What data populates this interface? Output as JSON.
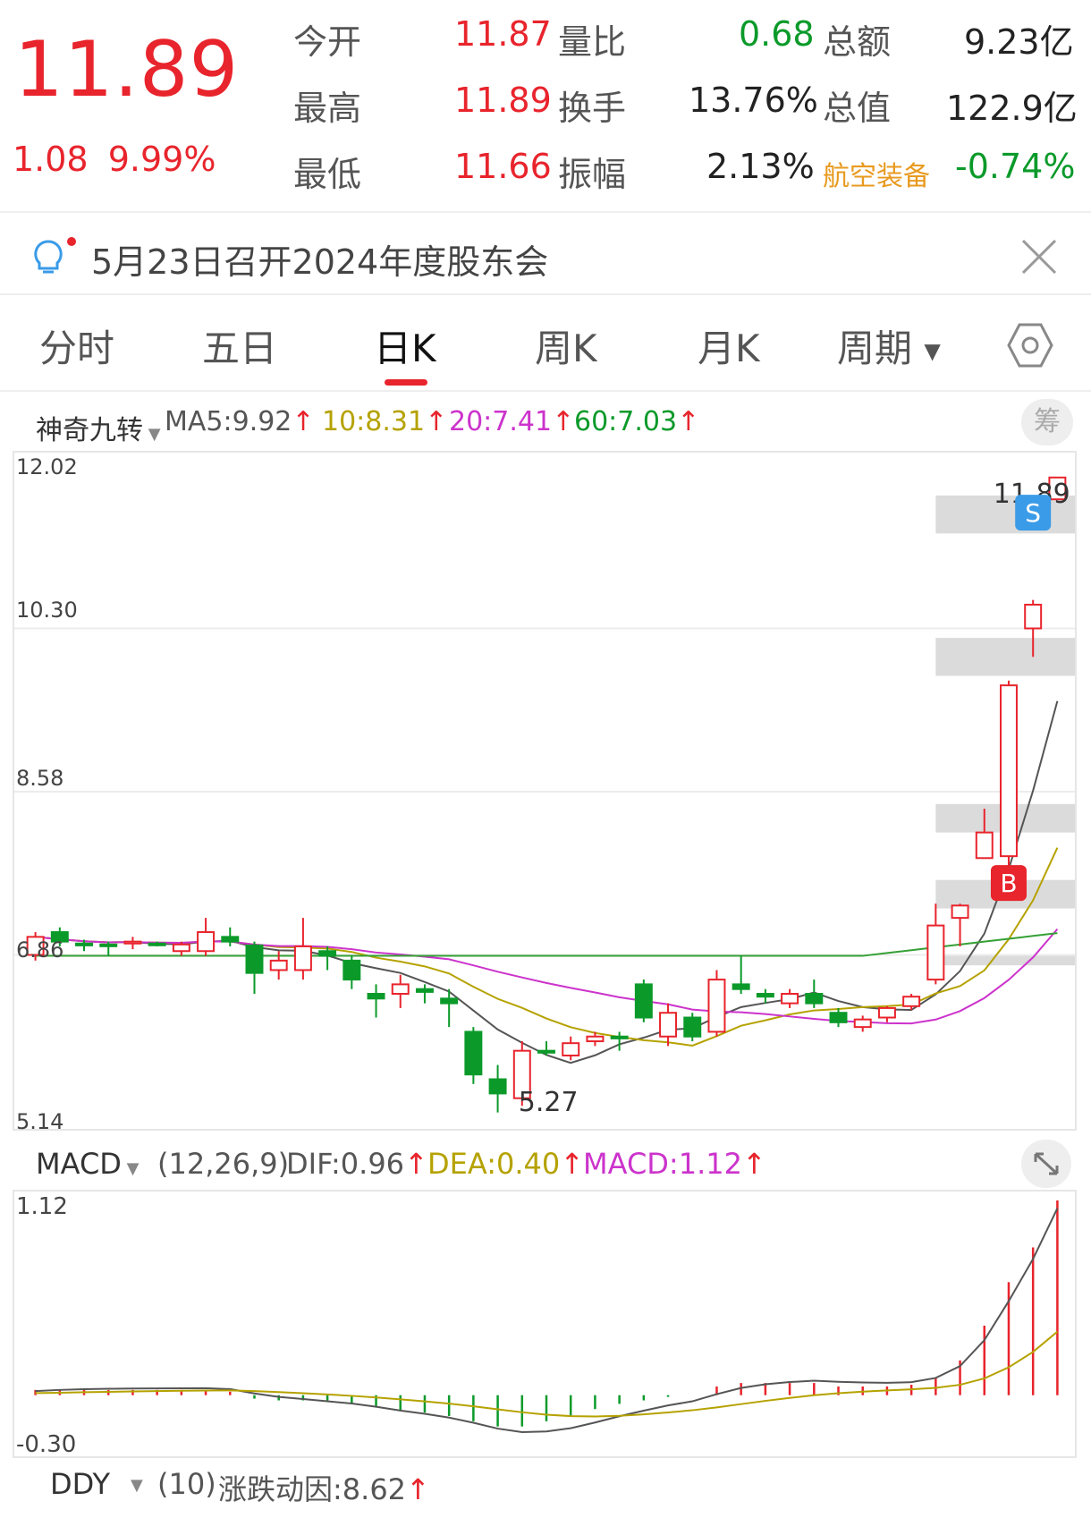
{
  "quote": {
    "price": "11.89",
    "change": "1.08",
    "change_pct": "9.99%",
    "fields": [
      {
        "label": "今开",
        "value": "11.87",
        "color": "#e8242c"
      },
      {
        "label": "量比",
        "value": "0.68",
        "color": "#0b9a2a"
      },
      {
        "label": "总额",
        "value": "9.23亿",
        "color": "#222222"
      },
      {
        "label": "最高",
        "value": "11.89",
        "color": "#e8242c"
      },
      {
        "label": "换手",
        "value": "13.76%",
        "color": "#222222"
      },
      {
        "label": "总值",
        "value": "122.9亿",
        "color": "#222222"
      },
      {
        "label": "最低",
        "value": "11.66",
        "color": "#e8242c"
      },
      {
        "label": "振幅",
        "value": "2.13%",
        "color": "#222222"
      }
    ],
    "sector": {
      "name": "航空装备",
      "change": "-0.74%",
      "name_color": "#e89a1f",
      "change_color": "#0b9a2a"
    }
  },
  "notice": {
    "text": "5月23日召开2024年度股东会",
    "icon": "lightbulb-icon",
    "close_icon": "close-icon"
  },
  "tabs": [
    {
      "label": "分时",
      "active": false
    },
    {
      "label": "五日",
      "active": false
    },
    {
      "label": "日K",
      "active": true
    },
    {
      "label": "周K",
      "active": false
    },
    {
      "label": "月K",
      "active": false
    },
    {
      "label": "周期",
      "active": false,
      "dropdown": true
    }
  ],
  "settings_icon": "hexagon-settings-icon",
  "indicator": {
    "name": "神奇九转",
    "ma5": "MA5:9.92",
    "ma10": "10:8.31",
    "ma20": "20:7.41",
    "ma60": "60:7.03",
    "chip_label": "筹"
  },
  "kline_axis": {
    "top": "12.02",
    "mid1": "10.30",
    "mid2": "8.58",
    "low_label": "6.86",
    "bottom": "5.14"
  },
  "kline_annotations": {
    "high": "11.89",
    "low": "5.27",
    "buy": "B",
    "sell": "S"
  },
  "macd": {
    "name": "MACD",
    "params": "(12,26,9)",
    "dif": "DIF:0.96",
    "dea": "DEA:0.40",
    "macd": "MACD:1.12",
    "axis_top": "1.12",
    "axis_bottom": "-0.30"
  },
  "ddy": {
    "name": "DDY",
    "params": "(10)",
    "value": "涨跌动因:8.62"
  },
  "chart_data": {
    "type": "candlestick",
    "ylim": [
      5.14,
      12.02
    ],
    "candles": [
      {
        "o": 6.86,
        "c": 7.05,
        "h": 7.1,
        "l": 6.8
      },
      {
        "o": 7.1,
        "c": 7.0,
        "h": 7.15,
        "l": 6.95
      },
      {
        "o": 6.98,
        "c": 6.96,
        "h": 7.02,
        "l": 6.9
      },
      {
        "o": 6.97,
        "c": 6.96,
        "h": 7.0,
        "l": 6.85
      },
      {
        "o": 6.98,
        "c": 7.0,
        "h": 7.05,
        "l": 6.92
      },
      {
        "o": 6.98,
        "c": 6.97,
        "h": 7.0,
        "l": 6.95
      },
      {
        "o": 6.9,
        "c": 6.97,
        "h": 7.0,
        "l": 6.85
      },
      {
        "o": 6.9,
        "c": 7.1,
        "h": 7.25,
        "l": 6.85
      },
      {
        "o": 7.05,
        "c": 7.0,
        "h": 7.15,
        "l": 6.95
      },
      {
        "o": 6.96,
        "c": 6.67,
        "h": 7.0,
        "l": 6.45
      },
      {
        "o": 6.7,
        "c": 6.8,
        "h": 6.9,
        "l": 6.6
      },
      {
        "o": 6.7,
        "c": 6.95,
        "h": 7.25,
        "l": 6.6
      },
      {
        "o": 6.9,
        "c": 6.85,
        "h": 6.95,
        "l": 6.7
      },
      {
        "o": 6.8,
        "c": 6.6,
        "h": 6.85,
        "l": 6.5
      },
      {
        "o": 6.45,
        "c": 6.4,
        "h": 6.55,
        "l": 6.2
      },
      {
        "o": 6.45,
        "c": 6.55,
        "h": 6.65,
        "l": 6.3
      },
      {
        "o": 6.5,
        "c": 6.47,
        "h": 6.55,
        "l": 6.35
      },
      {
        "o": 6.4,
        "c": 6.35,
        "h": 6.5,
        "l": 6.1
      },
      {
        "o": 6.05,
        "c": 5.6,
        "h": 6.1,
        "l": 5.5
      },
      {
        "o": 5.55,
        "c": 5.4,
        "h": 5.7,
        "l": 5.2
      },
      {
        "o": 5.35,
        "c": 5.85,
        "h": 5.95,
        "l": 5.27
      },
      {
        "o": 5.85,
        "c": 5.83,
        "h": 5.95,
        "l": 5.8
      },
      {
        "o": 5.8,
        "c": 5.93,
        "h": 6.0,
        "l": 5.75
      },
      {
        "o": 5.95,
        "c": 6.0,
        "h": 6.05,
        "l": 5.9
      },
      {
        "o": 6.0,
        "c": 5.98,
        "h": 6.05,
        "l": 5.85
      },
      {
        "o": 6.55,
        "c": 6.2,
        "h": 6.6,
        "l": 6.15
      },
      {
        "o": 6.0,
        "c": 6.25,
        "h": 6.35,
        "l": 5.9
      },
      {
        "o": 6.2,
        "c": 6.0,
        "h": 6.25,
        "l": 5.95
      },
      {
        "o": 6.05,
        "c": 6.6,
        "h": 6.7,
        "l": 6.0
      },
      {
        "o": 6.55,
        "c": 6.5,
        "h": 6.85,
        "l": 6.45
      },
      {
        "o": 6.45,
        "c": 6.42,
        "h": 6.5,
        "l": 6.35
      },
      {
        "o": 6.35,
        "c": 6.45,
        "h": 6.5,
        "l": 6.3
      },
      {
        "o": 6.45,
        "c": 6.35,
        "h": 6.6,
        "l": 6.3
      },
      {
        "o": 6.25,
        "c": 6.15,
        "h": 6.3,
        "l": 6.1
      },
      {
        "o": 6.1,
        "c": 6.18,
        "h": 6.22,
        "l": 6.05
      },
      {
        "o": 6.2,
        "c": 6.3,
        "h": 6.32,
        "l": 6.15
      },
      {
        "o": 6.32,
        "c": 6.42,
        "h": 6.45,
        "l": 6.28
      },
      {
        "o": 6.6,
        "c": 7.17,
        "h": 7.4,
        "l": 6.55
      },
      {
        "o": 7.25,
        "c": 7.38,
        "h": 7.4,
        "l": 6.95
      },
      {
        "o": 7.88,
        "c": 8.15,
        "h": 8.4,
        "l": 7.88
      },
      {
        "o": 7.9,
        "c": 9.7,
        "h": 9.75,
        "l": 7.75
      },
      {
        "o": 10.3,
        "c": 10.55,
        "h": 10.6,
        "l": 10.0
      },
      {
        "o": 11.66,
        "c": 11.89,
        "h": 11.89,
        "l": 11.66
      }
    ],
    "ma5_label": "MA5",
    "ma10_label": "10",
    "ma20_label": "20",
    "ma60_label": "60"
  },
  "macd_data": {
    "ylim": [
      -0.3,
      1.12
    ],
    "hist": [
      0.03,
      0.03,
      0.03,
      0.03,
      0.03,
      0.03,
      0.03,
      0.03,
      0.02,
      -0.02,
      -0.03,
      -0.03,
      -0.04,
      -0.05,
      -0.07,
      -0.09,
      -0.1,
      -0.12,
      -0.15,
      -0.18,
      -0.18,
      -0.15,
      -0.12,
      -0.08,
      -0.05,
      -0.03,
      -0.01,
      0.0,
      0.05,
      0.07,
      0.07,
      0.07,
      0.07,
      0.05,
      0.05,
      0.05,
      0.06,
      0.1,
      0.2,
      0.4,
      0.65,
      0.85,
      1.12
    ]
  },
  "colors": {
    "up": "#e8242c",
    "down": "#0b9a2a",
    "ma5": "#555555",
    "ma10": "#b5a200",
    "ma20": "#cc33cc",
    "ma60": "#35a035",
    "band": "#cccccc"
  }
}
